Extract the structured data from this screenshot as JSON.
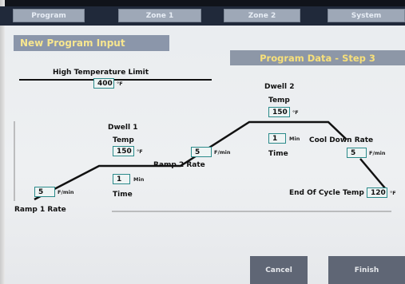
{
  "tabs": [
    {
      "label": "Program"
    },
    {
      "label": "Zone 1"
    },
    {
      "label": "Zone 2"
    },
    {
      "label": "System"
    }
  ],
  "panel_title": "New Program Input",
  "step_title": "Program Data - Step 3",
  "high_temp": {
    "label": "High Temperature Limit",
    "value": "400",
    "unit": "°F"
  },
  "ramp1": {
    "label": "Ramp 1 Rate",
    "value": "5",
    "unit": "F/min"
  },
  "dwell1": {
    "label": "Dwell 1",
    "temp_label": "Temp",
    "temp_value": "150",
    "temp_unit": "°F",
    "time_value": "1",
    "time_unit": "Min",
    "time_label": "Time"
  },
  "ramp2": {
    "label": "Ramp 2 Rate",
    "value": "5",
    "unit": "F/min"
  },
  "dwell2": {
    "label": "Dwell 2",
    "temp_label": "Temp",
    "temp_value": "150",
    "temp_unit": "°F",
    "time_value": "1",
    "time_unit": "Min",
    "time_label": "Time"
  },
  "cooldown": {
    "label": "Cool Down Rate",
    "value": "5",
    "unit": "F/min"
  },
  "end_cycle": {
    "label": "End Of Cycle Temp",
    "value": "120",
    "unit": "°F"
  },
  "buttons": {
    "cancel": "Cancel",
    "finish": "Finish"
  }
}
